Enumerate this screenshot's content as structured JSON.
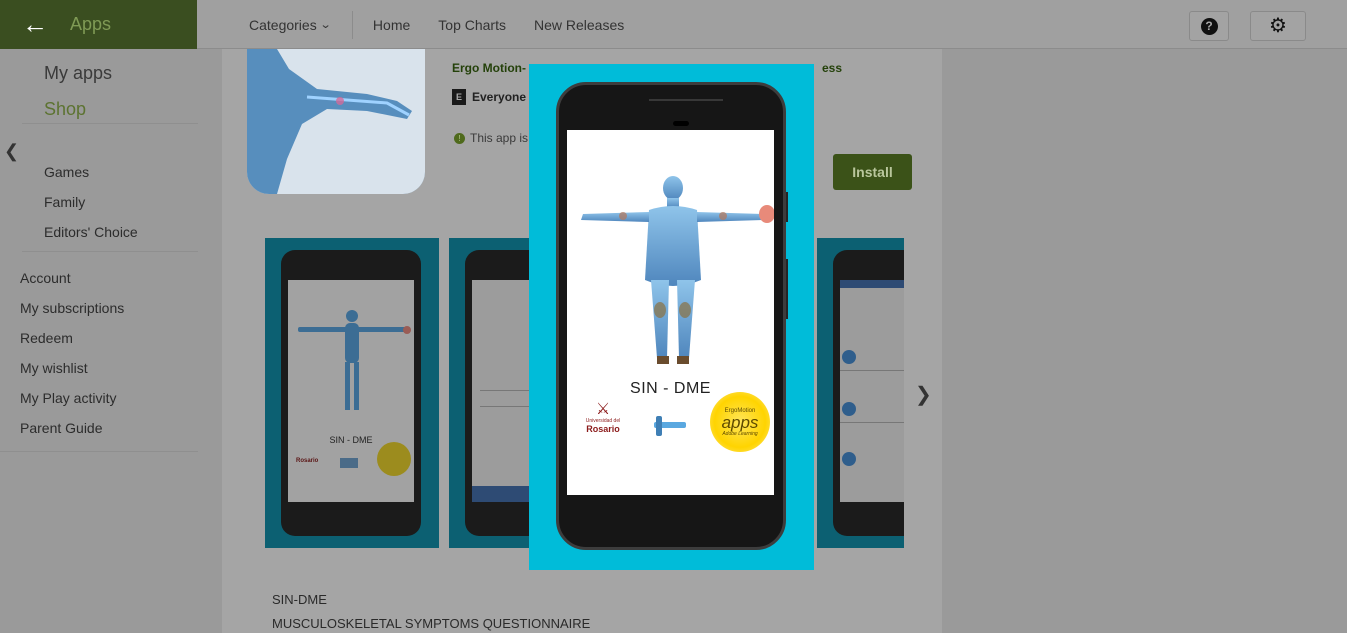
{
  "header": {
    "app_section": "Apps",
    "nav": {
      "categories": "Categories",
      "home": "Home",
      "top_charts": "Top Charts",
      "new_releases": "New Releases"
    },
    "help_icon": "help-icon",
    "settings_icon": "gear-icon"
  },
  "sidebar": {
    "sub_nav": {
      "my_apps": "My apps",
      "shop": "Shop"
    },
    "categories": [
      "Games",
      "Family",
      "Editors' Choice"
    ],
    "account": [
      "Account",
      "My subscriptions",
      "Redeem",
      "My wishlist",
      "My Play activity",
      "Parent Guide"
    ]
  },
  "app": {
    "title_prefix": "Ergo Motion-",
    "title_suffix": "ess",
    "rating": "Everyone",
    "compat_prefix": "This app is",
    "install_label": "Install"
  },
  "description": {
    "line1": "SIN-DME",
    "line2": "MUSCULOSKELETAL SYMPTOMS QUESTIONNAIRE"
  },
  "lightbox": {
    "screen_title": "SIN - DME",
    "university_top": "Universidad del",
    "university_name": "Rosario",
    "apps_badge_top": "ErgoMotion",
    "apps_badge": "apps",
    "apps_badge_sig": "Adobe Learning"
  },
  "thumbnail": {
    "screen_title": "SIN - DME",
    "university_name": "Rosario"
  },
  "colors": {
    "brand_bar": "#3a4e20",
    "install_button": "#3b5218",
    "lightbox_bg": "#00bcd9"
  }
}
